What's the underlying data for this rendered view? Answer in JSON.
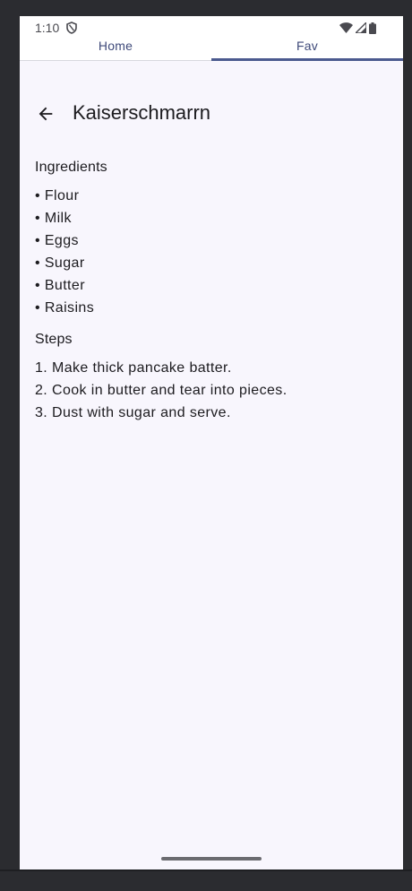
{
  "status_bar": {
    "time": "1:10"
  },
  "tabs": [
    {
      "label": "Home",
      "selected": false
    },
    {
      "label": "Fav",
      "selected": true
    }
  ],
  "colors": {
    "accent": "#4b5a8f",
    "tab_text": "#3f4a7a",
    "background": "#f8f6fd"
  },
  "icons": {
    "back": "arrow-back-icon",
    "shield": "shield-icon",
    "wifi": "wifi-icon",
    "signal": "cell-signal-icon",
    "battery": "battery-icon"
  },
  "recipe": {
    "title": "Kaiserschmarrn",
    "ingredients_heading": "Ingredients",
    "ingredients": [
      "• Flour",
      "• Milk",
      "• Eggs",
      "• Sugar",
      "• Butter",
      "• Raisins"
    ],
    "steps_heading": "Steps",
    "steps": [
      "1. Make thick pancake batter.",
      "2. Cook in butter and tear into pieces.",
      "3. Dust with sugar and serve."
    ]
  }
}
